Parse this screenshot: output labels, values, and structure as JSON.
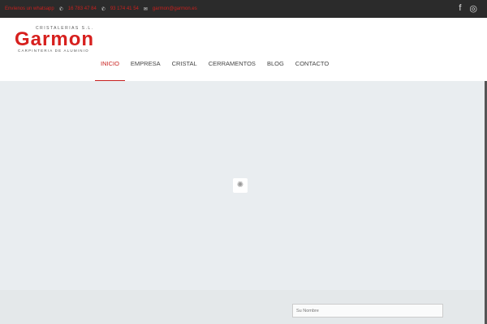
{
  "topbar": {
    "whatsapp": "Envíenos un whatsapp",
    "phone1": "16 783 47 84",
    "phone2": "93 174 41 54",
    "email": "garmon@garmon.es"
  },
  "logo": {
    "brand": "Garmon",
    "line1": "CRISTALERIAS S.L.",
    "line2": "CARPINTERIA DE ALUMINIO"
  },
  "nav": [
    {
      "label": "INICIO"
    },
    {
      "label": "EMPRESA"
    },
    {
      "label": "CRISTAL"
    },
    {
      "label": "CERRAMENTOS"
    },
    {
      "label": "BLOG"
    },
    {
      "label": "CONTACTO"
    }
  ],
  "form": {
    "name_placeholder": "Su Nombre"
  },
  "colors": {
    "accent": "#c8201e"
  }
}
